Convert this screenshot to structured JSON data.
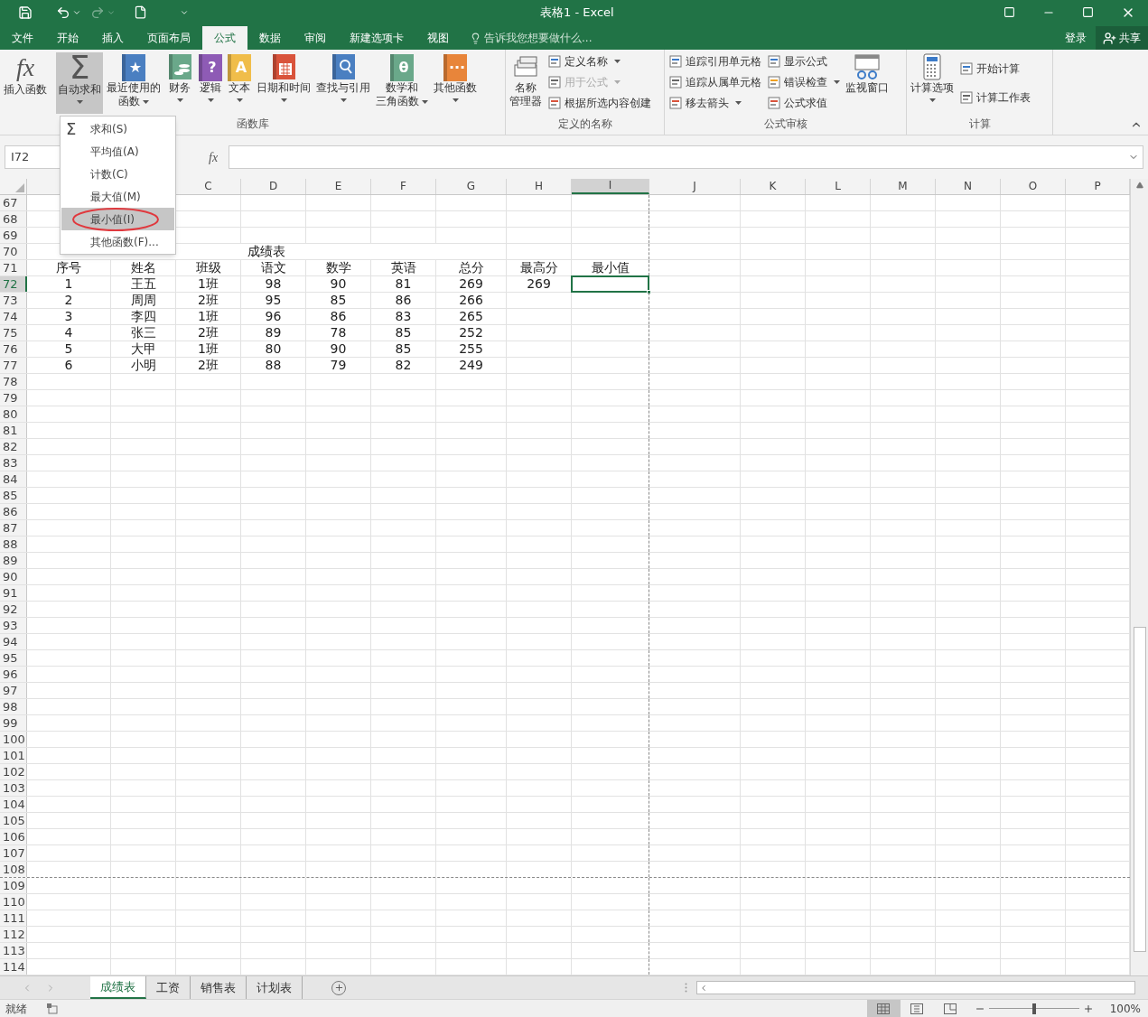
{
  "window": {
    "title": "表格1 - Excel",
    "tell_me": "告诉我您想要做什么...",
    "sign_in": "登录",
    "share": "共享"
  },
  "tabs": [
    {
      "label": "文件",
      "selected": false
    },
    {
      "label": "开始",
      "selected": false
    },
    {
      "label": "插入",
      "selected": false
    },
    {
      "label": "页面布局",
      "selected": false
    },
    {
      "label": "公式",
      "selected": true
    },
    {
      "label": "数据",
      "selected": false
    },
    {
      "label": "审阅",
      "selected": false
    },
    {
      "label": "新建选项卡",
      "selected": false
    },
    {
      "label": "视图",
      "selected": false
    }
  ],
  "ribbon": {
    "groups": [
      {
        "label": "函数库",
        "items": [
          {
            "kind": "large",
            "symbol": "fx",
            "lines": [
              "插入函数"
            ],
            "menu": false,
            "pressed": false
          },
          {
            "kind": "large",
            "symbol": "Σ",
            "lines": [
              "自动求和"
            ],
            "menu": true,
            "pressed": true
          },
          {
            "kind": "large",
            "symbol": "★",
            "color": "#4a7fc1",
            "lines": [
              "最近使用的",
              "函数"
            ],
            "menu": true,
            "pressed": false
          },
          {
            "kind": "large",
            "color": "#6aa88a",
            "lines": [
              "财务"
            ],
            "menu": true,
            "pressed": false
          },
          {
            "kind": "large",
            "symbol": "?",
            "color": "#8e5bb5",
            "lines": [
              "逻辑"
            ],
            "menu": true,
            "pressed": false
          },
          {
            "kind": "large",
            "symbol": "A",
            "color": "#f0bd4a",
            "lines": [
              "文本"
            ],
            "menu": true,
            "pressed": false
          },
          {
            "kind": "large",
            "color": "#d9533b",
            "lines": [
              "日期和时间"
            ],
            "menu": true,
            "pressed": false
          },
          {
            "kind": "large",
            "color": "#4a7fc1",
            "lines": [
              "查找与引用"
            ],
            "menu": true,
            "pressed": false
          },
          {
            "kind": "large",
            "symbol": "θ",
            "color": "#6aa88a",
            "lines": [
              "数学和",
              "三角函数"
            ],
            "menu": true,
            "pressed": false
          },
          {
            "kind": "large",
            "symbol": "···",
            "color": "#e8853a",
            "lines": [
              "其他函数"
            ],
            "menu": true,
            "pressed": false
          }
        ]
      },
      {
        "label": "定义的名称",
        "items": [
          {
            "kind": "large",
            "lines": [
              "名称",
              "管理器"
            ],
            "menu": false,
            "pressed": false
          },
          {
            "kind": "stack",
            "items": [
              {
                "label": "定义名称",
                "menu": true,
                "disabled": false
              },
              {
                "label": "用于公式",
                "menu": true,
                "disabled": true
              },
              {
                "label": "根据所选内容创建",
                "menu": false,
                "disabled": false
              }
            ]
          }
        ]
      },
      {
        "label": "公式审核",
        "items": [
          {
            "kind": "stack",
            "items": [
              {
                "label": "追踪引用单元格",
                "menu": false,
                "disabled": false
              },
              {
                "label": "追踪从属单元格",
                "menu": false,
                "disabled": false
              },
              {
                "label": "移去箭头",
                "menu": true,
                "disabled": false
              }
            ]
          },
          {
            "kind": "stack",
            "items": [
              {
                "label": "显示公式",
                "menu": false,
                "disabled": false
              },
              {
                "label": "错误检查",
                "menu": true,
                "disabled": false
              },
              {
                "label": "公式求值",
                "menu": false,
                "disabled": false
              }
            ]
          },
          {
            "kind": "large",
            "lines": [
              "监视窗口"
            ],
            "menu": false,
            "pressed": false
          }
        ]
      },
      {
        "label": "计算",
        "items": [
          {
            "kind": "large",
            "lines": [
              "计算选项"
            ],
            "menu": true,
            "pressed": false
          },
          {
            "kind": "stack",
            "items": [
              {
                "label": "开始计算",
                "menu": false,
                "disabled": false
              },
              {
                "label": "计算工作表",
                "menu": false,
                "disabled": false
              }
            ]
          }
        ]
      }
    ]
  },
  "autosum_menu": [
    {
      "label": "求和(S)",
      "symbol": "Σ",
      "selected": false
    },
    {
      "label": "平均值(A)",
      "selected": false
    },
    {
      "label": "计数(C)",
      "selected": false
    },
    {
      "label": "最大值(M)",
      "selected": false
    },
    {
      "label": "最小值(I)",
      "selected": true
    },
    {
      "label": "其他函数(F)...",
      "selected": false
    }
  ],
  "formula_bar": {
    "name_box": "I72",
    "function_button": "fx"
  },
  "columns": [
    {},
    {},
    {
      "label": "C",
      "selected": false
    },
    {
      "label": "D",
      "selected": false
    },
    {
      "label": "E",
      "selected": false
    },
    {
      "label": "F",
      "selected": false
    },
    {
      "label": "G",
      "selected": false
    },
    {
      "label": "H",
      "selected": false
    },
    {
      "label": "I",
      "selected": true,
      "page_break": true
    },
    {
      "label": "J",
      "selected": false
    },
    {
      "label": "K",
      "selected": false
    },
    {
      "label": "L",
      "selected": false
    },
    {
      "label": "M",
      "selected": false
    },
    {
      "label": "N",
      "selected": false
    },
    {
      "label": "O",
      "selected": false
    },
    {
      "label": "P",
      "selected": false
    }
  ],
  "rows": [
    {
      "number": "67",
      "selected": false
    },
    {
      "number": "68",
      "selected": false
    },
    {
      "number": "69",
      "selected": false
    },
    {
      "number": "70",
      "selected": false,
      "title": "成绩表"
    },
    {
      "number": "71",
      "selected": false,
      "cells": [
        "序号",
        "姓名",
        "班级",
        "语文",
        "数学",
        "英语",
        "总分",
        "最高分",
        "最小值"
      ]
    },
    {
      "number": "72",
      "selected": true,
      "cells": [
        "1",
        "王五",
        "1班",
        "98",
        "90",
        "81",
        "269",
        "269",
        null
      ]
    },
    {
      "number": "73",
      "selected": false,
      "cells": [
        "2",
        "周周",
        "2班",
        "95",
        "85",
        "86",
        "266",
        null,
        null
      ]
    },
    {
      "number": "74",
      "selected": false,
      "cells": [
        "3",
        "李四",
        "1班",
        "96",
        "86",
        "83",
        "265",
        null,
        null
      ]
    },
    {
      "number": "75",
      "selected": false,
      "cells": [
        "4",
        "张三",
        "2班",
        "89",
        "78",
        "85",
        "252",
        null,
        null
      ]
    },
    {
      "number": "76",
      "selected": false,
      "cells": [
        "5",
        "大甲",
        "1班",
        "80",
        "90",
        "85",
        "255",
        null,
        null
      ]
    },
    {
      "number": "77",
      "selected": false,
      "cells": [
        "6",
        "小明",
        "2班",
        "88",
        "79",
        "82",
        "249",
        null,
        null
      ]
    },
    {
      "number": "78",
      "selected": false
    },
    {
      "number": "79",
      "selected": false
    },
    {
      "number": "80",
      "selected": false
    },
    {
      "number": "81",
      "selected": false
    },
    {
      "number": "82",
      "selected": false
    },
    {
      "number": "83",
      "selected": false
    },
    {
      "number": "84",
      "selected": false
    },
    {
      "number": "85",
      "selected": false
    },
    {
      "number": "86",
      "selected": false
    },
    {
      "number": "87",
      "selected": false
    },
    {
      "number": "88",
      "selected": false
    },
    {
      "number": "89",
      "selected": false
    },
    {
      "number": "90",
      "selected": false
    },
    {
      "number": "91",
      "selected": false
    },
    {
      "number": "92",
      "selected": false
    },
    {
      "number": "93",
      "selected": false
    },
    {
      "number": "94",
      "selected": false
    },
    {
      "number": "95",
      "selected": false
    },
    {
      "number": "96",
      "selected": false
    },
    {
      "number": "97",
      "selected": false
    },
    {
      "number": "98",
      "selected": false
    },
    {
      "number": "99",
      "selected": false
    },
    {
      "number": "100",
      "selected": false
    },
    {
      "number": "101",
      "selected": false
    },
    {
      "number": "102",
      "selected": false
    },
    {
      "number": "103",
      "selected": false
    },
    {
      "number": "104",
      "selected": false
    },
    {
      "number": "105",
      "selected": false
    },
    {
      "number": "106",
      "selected": false
    },
    {
      "number": "107",
      "selected": false
    },
    {
      "number": "108",
      "selected": false,
      "page_break": true
    },
    {
      "number": "109",
      "selected": false
    },
    {
      "number": "110",
      "selected": false
    },
    {
      "number": "111",
      "selected": false
    },
    {
      "number": "112",
      "selected": false
    },
    {
      "number": "113",
      "selected": false
    },
    {
      "number": "114",
      "selected": false
    }
  ],
  "sheet_tabs": [
    {
      "label": "成绩表",
      "selected": true
    },
    {
      "label": "工资",
      "selected": false
    },
    {
      "label": "销售表",
      "selected": false
    },
    {
      "label": "计划表",
      "selected": false
    }
  ],
  "status_bar": {
    "status": "就绪",
    "view": [
      {
        "selected": true
      },
      {
        "selected": false
      },
      {
        "selected": false
      }
    ],
    "zoom": {
      "level": 0.5,
      "reading": "100%"
    }
  }
}
